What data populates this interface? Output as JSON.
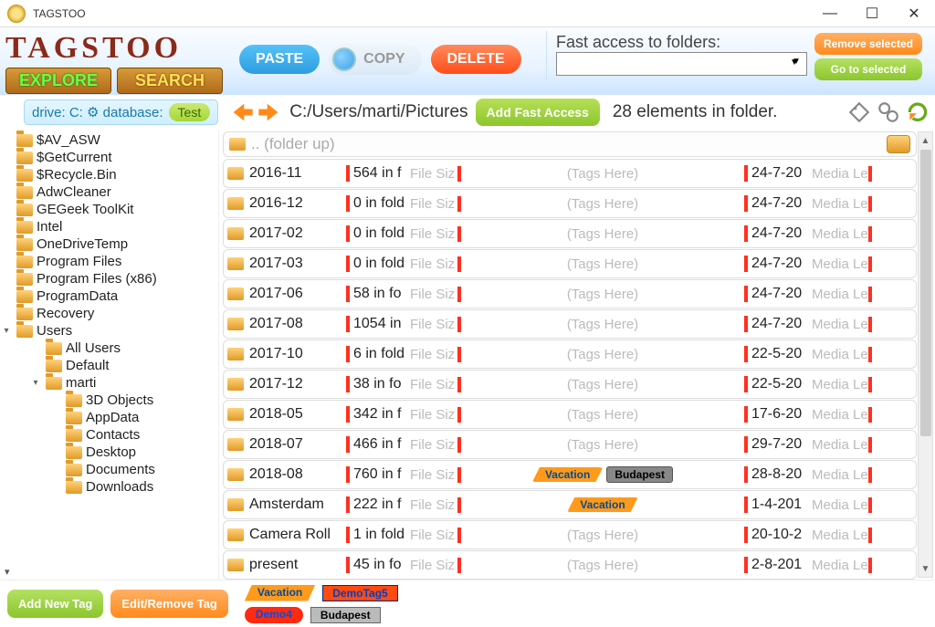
{
  "app": {
    "title": "TAGSTOO"
  },
  "logo": {
    "text": "TAGSTOO",
    "explore": "EXPLORE",
    "search": "SEARCH"
  },
  "toolbar": {
    "paste": "PASTE",
    "copy": "COPY",
    "delete": "DELETE"
  },
  "fast_access": {
    "label": "Fast access to folders:",
    "remove": "Remove selected",
    "go": "Go to selected"
  },
  "nav": {
    "drive_label": "drive: C: ⚙ database:",
    "test": "Test",
    "path": "C:/Users/marti/Pictures",
    "add_fast": "Add Fast Access",
    "count": "28 elements in folder."
  },
  "folder_up": ".. (folder up)",
  "placeholders": {
    "filesize": "File Siz",
    "tags": "(Tags Here)",
    "media": "Media Le"
  },
  "tree": [
    {
      "name": "$AV_ASW",
      "lvl": 0
    },
    {
      "name": "$GetCurrent",
      "lvl": 0
    },
    {
      "name": "$Recycle.Bin",
      "lvl": 0
    },
    {
      "name": "AdwCleaner",
      "lvl": 0
    },
    {
      "name": "GEGeek ToolKit",
      "lvl": 0
    },
    {
      "name": "Intel",
      "lvl": 0
    },
    {
      "name": "OneDriveTemp",
      "lvl": 0
    },
    {
      "name": "Program Files",
      "lvl": 0
    },
    {
      "name": "Program Files (x86)",
      "lvl": 0
    },
    {
      "name": "ProgramData",
      "lvl": 0
    },
    {
      "name": "Recovery",
      "lvl": 0
    },
    {
      "name": "Users",
      "lvl": 0,
      "open": true
    },
    {
      "name": "All Users",
      "lvl": 1
    },
    {
      "name": "Default",
      "lvl": 1
    },
    {
      "name": "marti",
      "lvl": 1,
      "open": true
    },
    {
      "name": "3D Objects",
      "lvl": 2
    },
    {
      "name": "AppData",
      "lvl": 2
    },
    {
      "name": "Contacts",
      "lvl": 2
    },
    {
      "name": "Desktop",
      "lvl": 2
    },
    {
      "name": "Documents",
      "lvl": 2
    },
    {
      "name": "Downloads",
      "lvl": 2
    }
  ],
  "rows": [
    {
      "name": "2016-11",
      "count": "564 in f",
      "date": "24-7-20",
      "tags": []
    },
    {
      "name": "2016-12",
      "count": "0 in fold",
      "date": "24-7-20",
      "tags": []
    },
    {
      "name": "2017-02",
      "count": "0 in fold",
      "date": "24-7-20",
      "tags": []
    },
    {
      "name": "2017-03",
      "count": "0 in fold",
      "date": "24-7-20",
      "tags": []
    },
    {
      "name": "2017-06",
      "count": "58 in fo",
      "date": "24-7-20",
      "tags": []
    },
    {
      "name": "2017-08",
      "count": "1054 in",
      "date": "24-7-20",
      "tags": []
    },
    {
      "name": "2017-10",
      "count": "6 in fold",
      "date": "22-5-20",
      "tags": []
    },
    {
      "name": "2017-12",
      "count": "38 in fo",
      "date": "22-5-20",
      "tags": []
    },
    {
      "name": "2018-05",
      "count": "342 in f",
      "date": "17-6-20",
      "tags": []
    },
    {
      "name": "2018-07",
      "count": "466 in f",
      "date": "29-7-20",
      "tags": []
    },
    {
      "name": "2018-08",
      "count": "760 in f",
      "date": "28-8-20",
      "tags": [
        {
          "t": "Vacation",
          "c": "vac"
        },
        {
          "t": "Budapest",
          "c": "bud"
        }
      ]
    },
    {
      "name": "Amsterdam",
      "count": "222 in f",
      "date": "1-4-201",
      "tags": [
        {
          "t": "Vacation",
          "c": "vac"
        }
      ]
    },
    {
      "name": "Camera Roll",
      "count": "1 in fold",
      "date": "20-10-2",
      "tags": []
    },
    {
      "name": "present",
      "count": "45 in fo",
      "date": "2-8-201",
      "tags": []
    }
  ],
  "palette": {
    "vacation": "Vacation",
    "demotag5": "DemoTag5",
    "demo4": "Demo4",
    "budapest": "Budapest"
  },
  "bottom": {
    "addnew": "Add New Tag",
    "editrem": "Edit/Remove Tag"
  }
}
